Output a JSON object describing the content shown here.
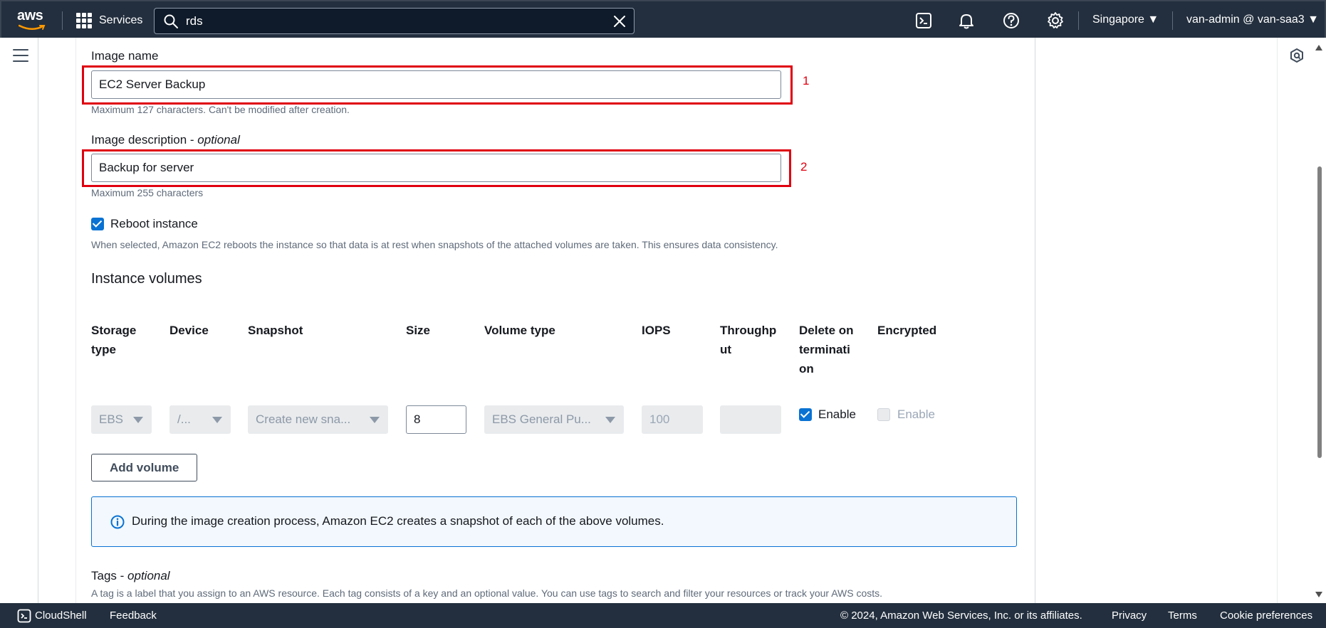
{
  "topnav": {
    "logo": "aws",
    "services_label": "Services",
    "search_value": "rds",
    "region": "Singapore ▼",
    "account": "van-admin @ van-saa3 ▼"
  },
  "form": {
    "image_name_label": "Image name",
    "image_name_value": "EC2 Server Backup",
    "image_name_help": "Maximum 127 characters. Can't be modified after creation.",
    "image_desc_label": "Image description - ",
    "image_desc_optional": "optional",
    "image_desc_value": "Backup for server",
    "image_desc_help": "Maximum 255 characters",
    "reboot_label": "Reboot instance",
    "reboot_help": "When selected, Amazon EC2 reboots the instance so that data is at rest when snapshots of the attached volumes are taken. This ensures data consistency.",
    "annotation_1": "1",
    "annotation_2": "2"
  },
  "volumes": {
    "title": "Instance volumes",
    "columns": {
      "storage_type": [
        "Storage",
        "type"
      ],
      "device": [
        "Device"
      ],
      "snapshot": [
        "Snapshot"
      ],
      "size": [
        "Size"
      ],
      "volume_type": [
        "Volume type"
      ],
      "iops": [
        "IOPS"
      ],
      "throughput": [
        "Throughp",
        "ut"
      ],
      "delete_on_termination": [
        "Delete on",
        "terminati",
        "on"
      ],
      "encrypted": [
        "Encrypted"
      ]
    },
    "row": {
      "storage_type": "EBS",
      "device": "/...",
      "snapshot": "Create new sna...",
      "size": "8",
      "volume_type": "EBS General Pu...",
      "iops": "100",
      "throughput": "",
      "delete_label": "Enable",
      "encrypted_label": "Enable"
    },
    "add_volume": "Add volume",
    "info": "During the image creation process, Amazon EC2 creates a snapshot of each of the above volumes."
  },
  "tags": {
    "title": "Tags - ",
    "optional": "optional",
    "help": "A tag is a label that you assign to an AWS resource. Each tag consists of a key and an optional value. You can use tags to search and filter your resources or track your AWS costs."
  },
  "footer": {
    "cloudshell": "CloudShell",
    "feedback": "Feedback",
    "copyright": "© 2024, Amazon Web Services, Inc. or its affiliates.",
    "privacy": "Privacy",
    "terms": "Terms",
    "cookies": "Cookie preferences"
  },
  "colors": {
    "nav_bg": "#232f3e",
    "accent": "#0972d3",
    "highlight": "#e0000f",
    "info_bg": "#f2f8fd"
  }
}
